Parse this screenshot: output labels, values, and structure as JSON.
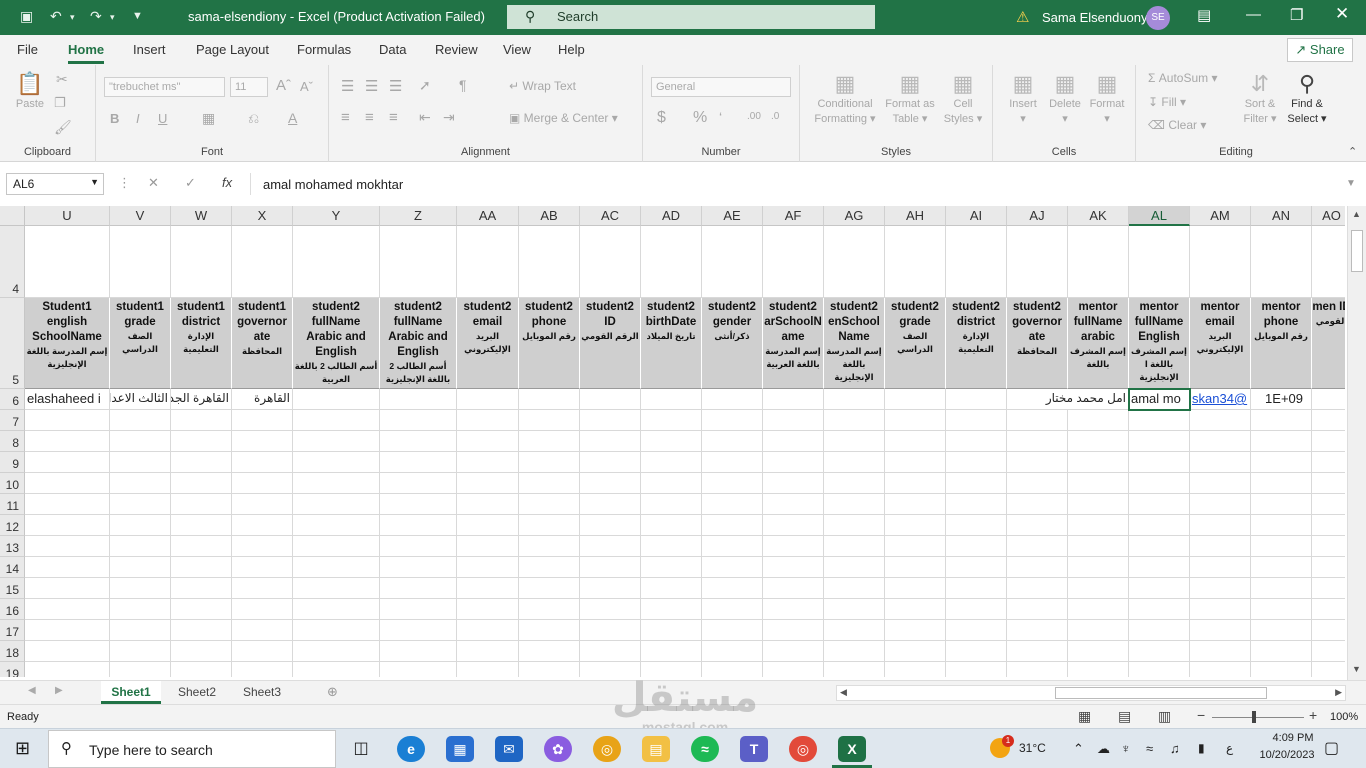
{
  "titlebar": {
    "title": "sama-elsendiony  -  Excel (Product Activation Failed)",
    "search_placeholder": "Search",
    "user_name": "Sama Elsenduony",
    "avatar_initials": "SE",
    "accent": "#217346"
  },
  "menu": {
    "tabs": [
      "File",
      "Home",
      "Insert",
      "Page Layout",
      "Formulas",
      "Data",
      "Review",
      "View",
      "Help"
    ],
    "active_tab": "Home",
    "share_label": "Share"
  },
  "ribbon": {
    "clipboard": {
      "label": "Clipboard",
      "paste": "Paste"
    },
    "font": {
      "label": "Font",
      "font_name": "\"trebuchet ms\"",
      "font_size": "11"
    },
    "alignment": {
      "label": "Alignment",
      "wrap_text": "Wrap Text",
      "merge_center": "Merge & Center"
    },
    "number": {
      "label": "Number",
      "format": "General"
    },
    "styles": {
      "label": "Styles",
      "conditional_line1": "Conditional",
      "conditional_line2": "Formatting",
      "format_table_line1": "Format as",
      "format_table_line2": "Table",
      "cell_styles_line1": "Cell",
      "cell_styles_line2": "Styles"
    },
    "cells": {
      "label": "Cells",
      "insert": "Insert",
      "delete": "Delete",
      "format": "Format"
    },
    "editing": {
      "label": "Editing",
      "autosum": "AutoSum",
      "fill": "Fill",
      "clear": "Clear",
      "sort_line1": "Sort &",
      "sort_line2": "Filter",
      "find_line1": "Find &",
      "find_line2": "Select"
    }
  },
  "formula_bar": {
    "name_box": "AL6",
    "content": "amal mohamed mokhtar"
  },
  "grid": {
    "columns": [
      "U",
      "V",
      "W",
      "X",
      "Y",
      "Z",
      "AA",
      "AB",
      "AC",
      "AD",
      "AE",
      "AF",
      "AG",
      "AH",
      "AI",
      "AJ",
      "AK",
      "AL",
      "AM",
      "AN",
      "AO"
    ],
    "selected_column": "AL",
    "rows": [
      "4",
      "5",
      "6",
      "7",
      "8",
      "9",
      "10",
      "11",
      "12",
      "13",
      "14",
      "15",
      "16",
      "17",
      "18",
      "19"
    ],
    "headers": [
      {
        "en": "Student1 english SchoolName",
        "ar": "إسم المدرسة باللغة الإنجليزية"
      },
      {
        "en": "student1 grade",
        "ar": "الصف الدراسي"
      },
      {
        "en": "student1 district",
        "ar": "الإدارة التعليمية"
      },
      {
        "en": "student1 governor ate",
        "ar": "المحافظة"
      },
      {
        "en": "student2 fullName Arabic and English",
        "ar": "أسم الطالب 2 باللغة العربية"
      },
      {
        "en": "student2 fullName Arabic and English",
        "ar": "أسم الطالب 2 باللغة الإنجليزية"
      },
      {
        "en": "student2 email",
        "ar": "البريد الإليكتروني"
      },
      {
        "en": "student2 phone",
        "ar": "رقم الموبايل"
      },
      {
        "en": "student2 ID",
        "ar": "الرقم القومي"
      },
      {
        "en": "student2 birthDate",
        "ar": "تاريخ الميلاد"
      },
      {
        "en": "student2 gender",
        "ar": "ذكر/أنثى"
      },
      {
        "en": "student2 arSchoolN ame",
        "ar": "إسم المدرسة باللغة العربية"
      },
      {
        "en": "student2 enSchool Name",
        "ar": "إسم المدرسة باللغة الإنجليزية"
      },
      {
        "en": "student2 grade",
        "ar": "الصف الدراسي"
      },
      {
        "en": "student2 district",
        "ar": "الإدارة التعليمية"
      },
      {
        "en": "student2 governor ate",
        "ar": "المحافظة"
      },
      {
        "en": "mentor fullName arabic",
        "ar": "إسم المشرف باللغة"
      },
      {
        "en": "mentor fullName English",
        "ar": "إسم المشرف باللغة ا الإنجليزية"
      },
      {
        "en": "mentor email",
        "ar": "البريد الإليكتروني"
      },
      {
        "en": "mentor phone",
        "ar": "رقم الموبايل"
      },
      {
        "en": "men ID",
        "ar": "القومي"
      }
    ],
    "row6": {
      "U": "elashaheed i",
      "V": "الثالث الاعدا",
      "W": "القاهرة الجد",
      "X": "القاهرة",
      "AK": "امل محمد مختار",
      "AL": "amal mo",
      "AM": "skan34@",
      "AN": "1E+09"
    }
  },
  "sheets": {
    "tabs": [
      "Sheet1",
      "Sheet2",
      "Sheet3"
    ],
    "active": "Sheet1"
  },
  "status": {
    "ready": "Ready",
    "zoom": "100%"
  },
  "taskbar": {
    "search_placeholder": "Type here to search",
    "temperature": "31°C",
    "lang": "ع",
    "time": "4:09 PM",
    "date": "10/20/2023",
    "notification_count": "1"
  },
  "watermark": {
    "arabic": "مستقل",
    "latin": "mostaql.com"
  }
}
